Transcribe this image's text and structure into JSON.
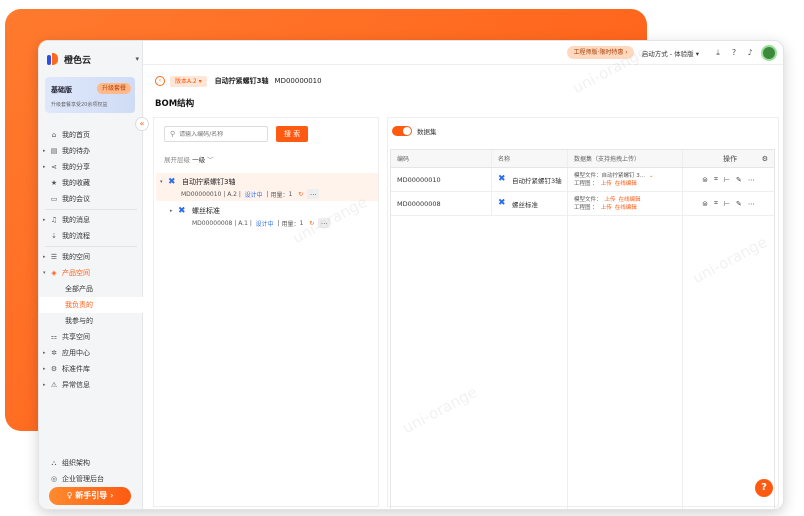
{
  "app": {
    "name": "橙色云"
  },
  "plan": {
    "title": "基础版",
    "upgrade_label": "升级套餐",
    "desc": "升级套餐享受20余项权益"
  },
  "nav": {
    "home": "我的首页",
    "todo": "我的待办",
    "share": "我的分享",
    "favorites": "我的收藏",
    "meetings": "我的会议",
    "messages": "我的消息",
    "flows": "我的流程",
    "spaces": "我的空间",
    "product_space": "产品空间",
    "sub_all": "全部产品",
    "sub_mine": "我负责的",
    "sub_joined": "我参与的",
    "shared_space": "共享空间",
    "app_center": "应用中心",
    "std_library": "标准件库",
    "exceptions": "异常信息"
  },
  "bottom_nav": {
    "org": "组织架构",
    "admin": "企业管理后台",
    "guide": "新手引导 ›"
  },
  "topbar": {
    "promo": "工程师版·限时特惠 ›",
    "contact": "启动方式 - 体验版 ▾"
  },
  "breadcrumb": {
    "version": "版本A.2 ▾",
    "name": "自动拧紧螺钉3轴",
    "code": "MD00000010"
  },
  "page_title": "BOM结构",
  "search": {
    "placeholder": "请输入编码/名称",
    "button": "搜 索"
  },
  "expand": {
    "label": "展开层级",
    "value": "一级"
  },
  "tree": [
    {
      "name": "自动拧紧螺钉3轴",
      "code": "MD00000010",
      "version": "A.2",
      "status": "设计中",
      "qty_label": "用量：",
      "qty": "1"
    },
    {
      "name": "螺丝标准",
      "code": "MD00000008",
      "version": "A.1",
      "status": "设计中",
      "qty_label": "用量：",
      "qty": "1"
    }
  ],
  "dataset_toggle": "数据集",
  "grid": {
    "headers": {
      "code": "编码",
      "name": "名称",
      "data": "数据集（支持拖拽上传）",
      "ops": "操作"
    },
    "rows": [
      {
        "code": "MD00000010",
        "name": "自动拧紧螺钉3轴",
        "model_label": "模型文件：",
        "model_value": "自动拧紧螺钉 3...",
        "drawing_label": "工程图 ：",
        "upload": "上传",
        "edit_online": "在线编辑"
      },
      {
        "code": "MD00000008",
        "name": "螺丝标准",
        "model_label": "模型文件：",
        "upload": "上传",
        "edit_online": "在线编辑",
        "drawing_label": "工程图 ："
      }
    ]
  },
  "help": "?",
  "watermark": "uni-orange"
}
